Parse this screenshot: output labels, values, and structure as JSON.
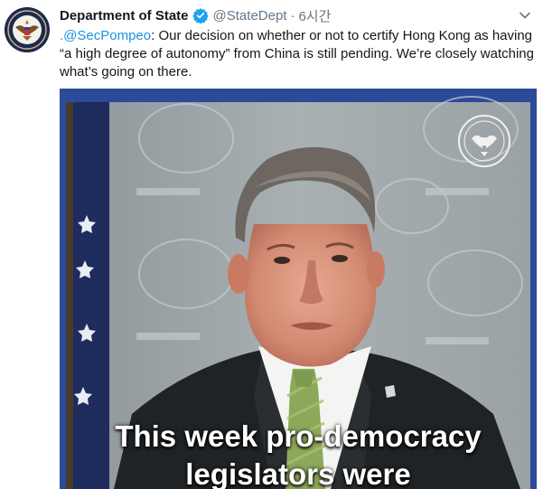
{
  "tweet": {
    "author": {
      "display_name": "Department of State",
      "handle": "@StateDept",
      "verified": true,
      "avatar_icon": "state-department-seal-icon"
    },
    "separator": "·",
    "time": "6시간",
    "mention": ".@SecPompeo",
    "body": ": Our decision on whether or not to certify Hong Kong as having “a high degree of autonomy” from China is still pending. We’re closely watching what’s going on there.",
    "media": {
      "type": "video",
      "caption_lines": [
        "This week pro-democracy",
        "legislators were"
      ],
      "watermark_icon": "state-department-seal-icon"
    }
  },
  "colors": {
    "link": "#1b95e0",
    "secondary_text": "#657786",
    "verified": "#1da1f2",
    "media_frame": "#2b4a9a"
  }
}
